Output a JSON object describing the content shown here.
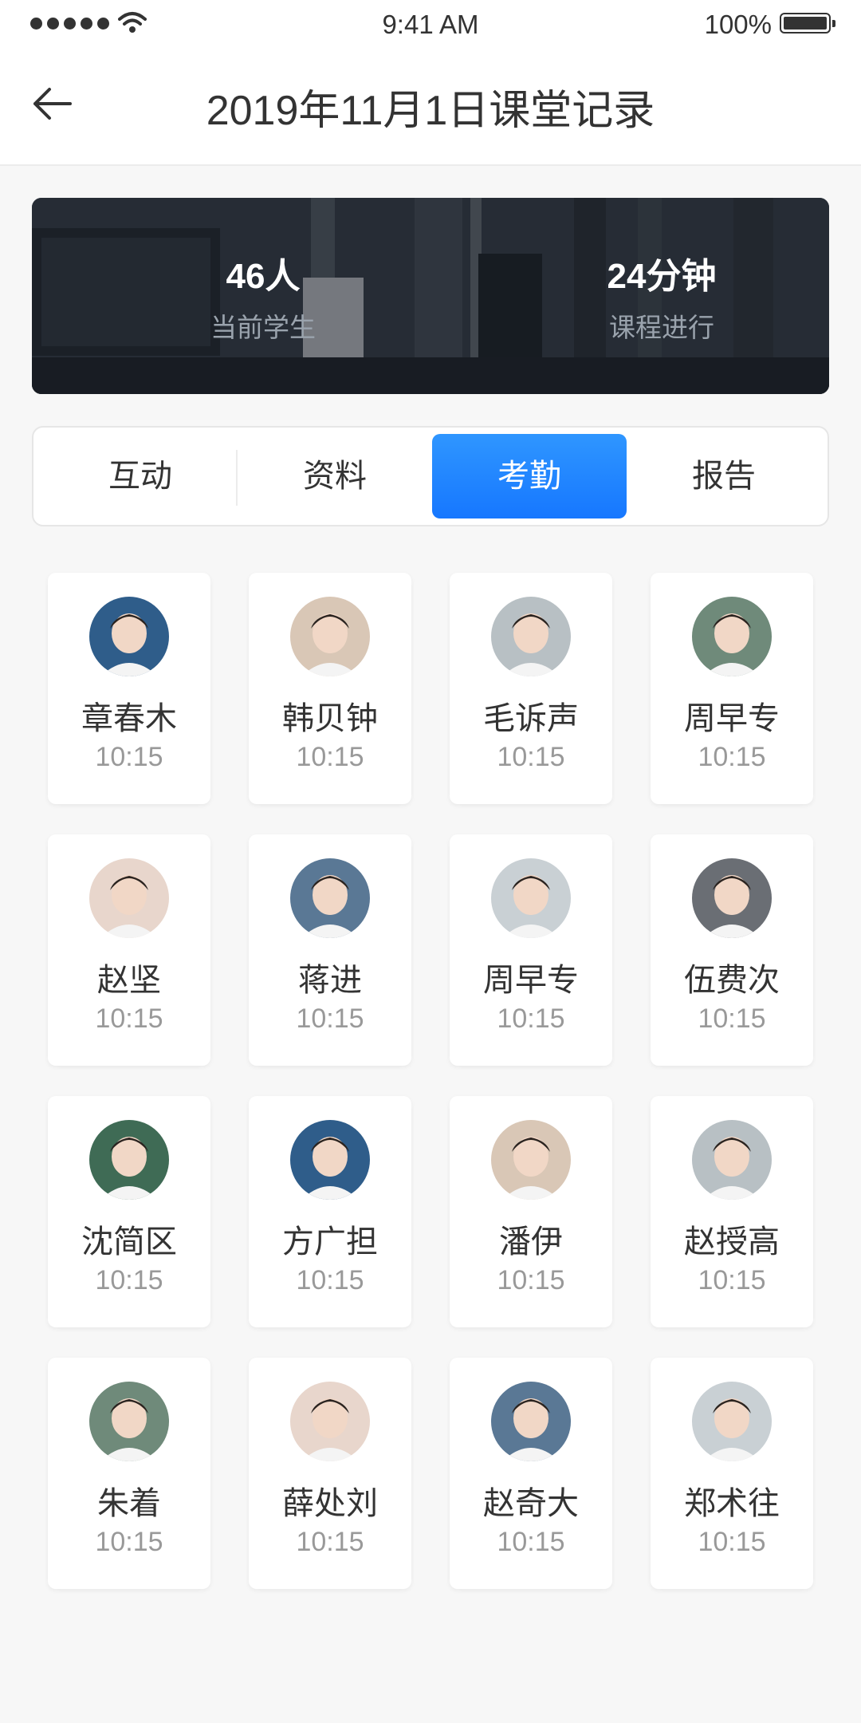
{
  "status_bar": {
    "time": "9:41 AM",
    "battery": "100%"
  },
  "header": {
    "title": "2019年11月1日课堂记录"
  },
  "summary": {
    "students": {
      "value": "46人",
      "label": "当前学生"
    },
    "duration": {
      "value": "24分钟",
      "label": "课程进行"
    }
  },
  "tabs": [
    {
      "label": "互动",
      "active": false
    },
    {
      "label": "资料",
      "active": false
    },
    {
      "label": "考勤",
      "active": true
    },
    {
      "label": "报告",
      "active": false
    }
  ],
  "students": [
    {
      "name": "章春木",
      "time": "10:15",
      "avatar_color": "#2f5d8a"
    },
    {
      "name": "韩贝钟",
      "time": "10:15",
      "avatar_color": "#d9c7b6"
    },
    {
      "name": "毛诉声",
      "time": "10:15",
      "avatar_color": "#b8c0c4"
    },
    {
      "name": "周早专",
      "time": "10:15",
      "avatar_color": "#6f8a7a"
    },
    {
      "name": "赵坚",
      "time": "10:15",
      "avatar_color": "#e8d6cc"
    },
    {
      "name": "蒋进",
      "time": "10:15",
      "avatar_color": "#5a7895"
    },
    {
      "name": "周早专",
      "time": "10:15",
      "avatar_color": "#c9d0d4"
    },
    {
      "name": "伍费次",
      "time": "10:15",
      "avatar_color": "#6a6e74"
    },
    {
      "name": "沈简区",
      "time": "10:15",
      "avatar_color": "#3f6b55"
    },
    {
      "name": "方广担",
      "time": "10:15",
      "avatar_color": "#2f5d8a"
    },
    {
      "name": "潘伊",
      "time": "10:15",
      "avatar_color": "#d9c7b6"
    },
    {
      "name": "赵授高",
      "time": "10:15",
      "avatar_color": "#b8c0c4"
    },
    {
      "name": "朱着",
      "time": "10:15",
      "avatar_color": "#6f8a7a"
    },
    {
      "name": "薛处刘",
      "time": "10:15",
      "avatar_color": "#e8d6cc"
    },
    {
      "name": "赵奇大",
      "time": "10:15",
      "avatar_color": "#5a7895"
    },
    {
      "name": "郑术往",
      "time": "10:15",
      "avatar_color": "#c9d0d4"
    }
  ]
}
